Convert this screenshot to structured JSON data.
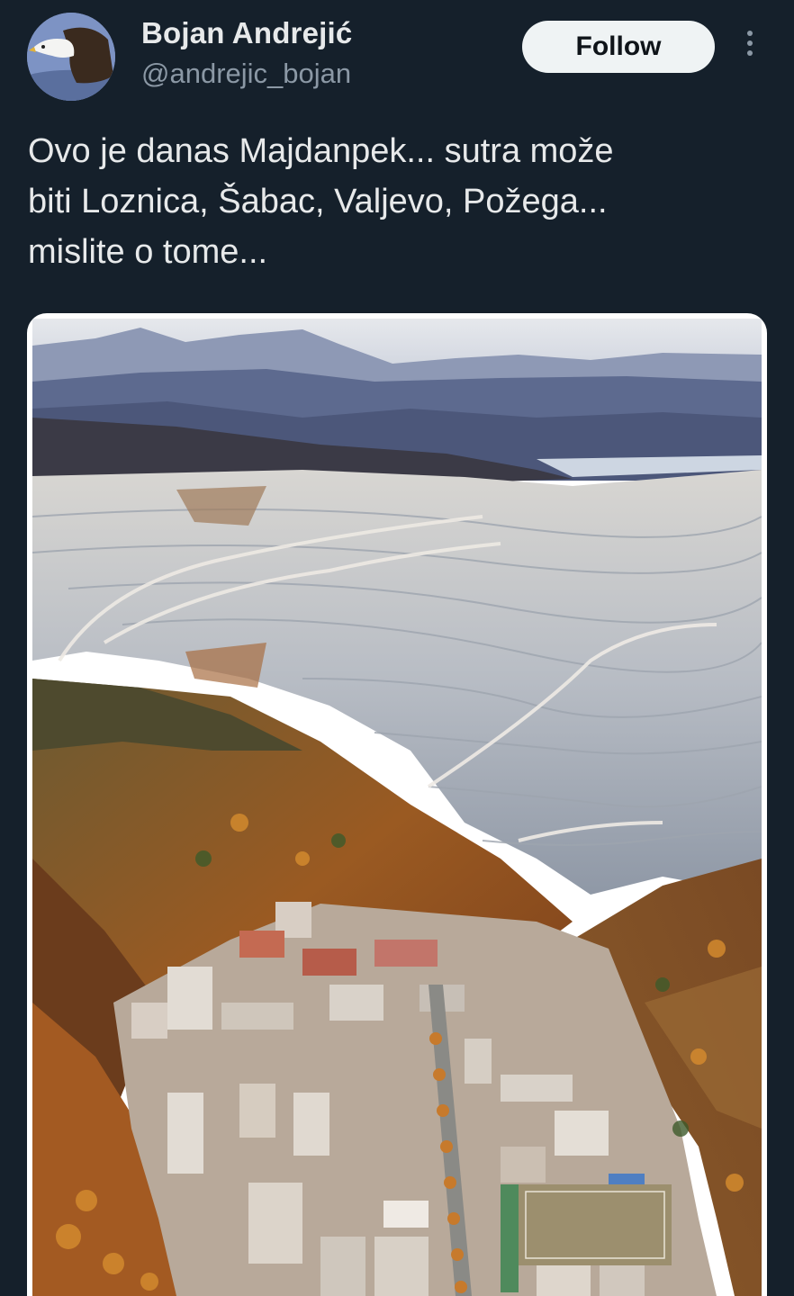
{
  "author": {
    "name": "Bojan Andrejić",
    "handle": "@andrejic_bojan",
    "avatar_icon": "eagle-avatar"
  },
  "actions": {
    "follow_label": "Follow",
    "more_icon": "more-options-icon"
  },
  "tweet": {
    "line1": "Ovo je danas Majdanpek... sutra može",
    "line2": "biti Loznica, Šabac, Valjevo, Požega...",
    "line3": "mislite o tome..."
  },
  "media": {
    "kind": "photo",
    "subject": "aerial-view-open-pit-mine-above-town"
  },
  "colors": {
    "background": "#15202b",
    "text": "#e7e9ea",
    "secondary_text": "#8b98a5",
    "follow_button_bg": "#eff3f4"
  }
}
